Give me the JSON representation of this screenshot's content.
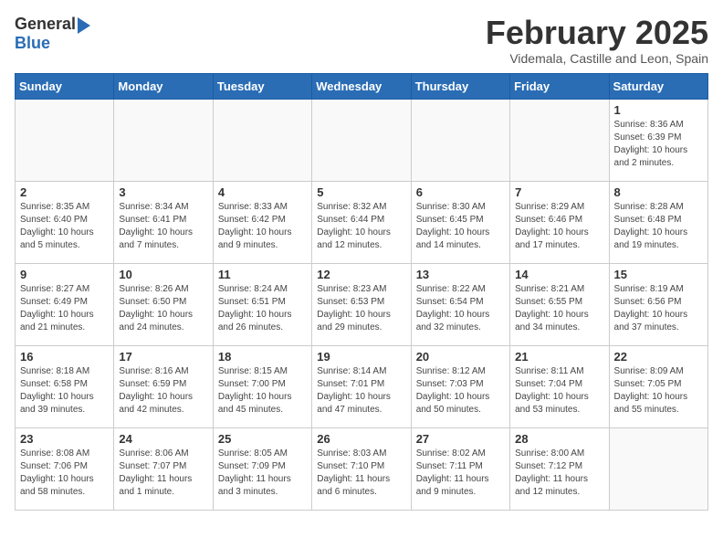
{
  "logo": {
    "general": "General",
    "blue": "Blue"
  },
  "title": "February 2025",
  "subtitle": "Videmala, Castille and Leon, Spain",
  "headers": [
    "Sunday",
    "Monday",
    "Tuesday",
    "Wednesday",
    "Thursday",
    "Friday",
    "Saturday"
  ],
  "weeks": [
    [
      {
        "day": "",
        "info": ""
      },
      {
        "day": "",
        "info": ""
      },
      {
        "day": "",
        "info": ""
      },
      {
        "day": "",
        "info": ""
      },
      {
        "day": "",
        "info": ""
      },
      {
        "day": "",
        "info": ""
      },
      {
        "day": "1",
        "info": "Sunrise: 8:36 AM\nSunset: 6:39 PM\nDaylight: 10 hours\nand 2 minutes."
      }
    ],
    [
      {
        "day": "2",
        "info": "Sunrise: 8:35 AM\nSunset: 6:40 PM\nDaylight: 10 hours\nand 5 minutes."
      },
      {
        "day": "3",
        "info": "Sunrise: 8:34 AM\nSunset: 6:41 PM\nDaylight: 10 hours\nand 7 minutes."
      },
      {
        "day": "4",
        "info": "Sunrise: 8:33 AM\nSunset: 6:42 PM\nDaylight: 10 hours\nand 9 minutes."
      },
      {
        "day": "5",
        "info": "Sunrise: 8:32 AM\nSunset: 6:44 PM\nDaylight: 10 hours\nand 12 minutes."
      },
      {
        "day": "6",
        "info": "Sunrise: 8:30 AM\nSunset: 6:45 PM\nDaylight: 10 hours\nand 14 minutes."
      },
      {
        "day": "7",
        "info": "Sunrise: 8:29 AM\nSunset: 6:46 PM\nDaylight: 10 hours\nand 17 minutes."
      },
      {
        "day": "8",
        "info": "Sunrise: 8:28 AM\nSunset: 6:48 PM\nDaylight: 10 hours\nand 19 minutes."
      }
    ],
    [
      {
        "day": "9",
        "info": "Sunrise: 8:27 AM\nSunset: 6:49 PM\nDaylight: 10 hours\nand 21 minutes."
      },
      {
        "day": "10",
        "info": "Sunrise: 8:26 AM\nSunset: 6:50 PM\nDaylight: 10 hours\nand 24 minutes."
      },
      {
        "day": "11",
        "info": "Sunrise: 8:24 AM\nSunset: 6:51 PM\nDaylight: 10 hours\nand 26 minutes."
      },
      {
        "day": "12",
        "info": "Sunrise: 8:23 AM\nSunset: 6:53 PM\nDaylight: 10 hours\nand 29 minutes."
      },
      {
        "day": "13",
        "info": "Sunrise: 8:22 AM\nSunset: 6:54 PM\nDaylight: 10 hours\nand 32 minutes."
      },
      {
        "day": "14",
        "info": "Sunrise: 8:21 AM\nSunset: 6:55 PM\nDaylight: 10 hours\nand 34 minutes."
      },
      {
        "day": "15",
        "info": "Sunrise: 8:19 AM\nSunset: 6:56 PM\nDaylight: 10 hours\nand 37 minutes."
      }
    ],
    [
      {
        "day": "16",
        "info": "Sunrise: 8:18 AM\nSunset: 6:58 PM\nDaylight: 10 hours\nand 39 minutes."
      },
      {
        "day": "17",
        "info": "Sunrise: 8:16 AM\nSunset: 6:59 PM\nDaylight: 10 hours\nand 42 minutes."
      },
      {
        "day": "18",
        "info": "Sunrise: 8:15 AM\nSunset: 7:00 PM\nDaylight: 10 hours\nand 45 minutes."
      },
      {
        "day": "19",
        "info": "Sunrise: 8:14 AM\nSunset: 7:01 PM\nDaylight: 10 hours\nand 47 minutes."
      },
      {
        "day": "20",
        "info": "Sunrise: 8:12 AM\nSunset: 7:03 PM\nDaylight: 10 hours\nand 50 minutes."
      },
      {
        "day": "21",
        "info": "Sunrise: 8:11 AM\nSunset: 7:04 PM\nDaylight: 10 hours\nand 53 minutes."
      },
      {
        "day": "22",
        "info": "Sunrise: 8:09 AM\nSunset: 7:05 PM\nDaylight: 10 hours\nand 55 minutes."
      }
    ],
    [
      {
        "day": "23",
        "info": "Sunrise: 8:08 AM\nSunset: 7:06 PM\nDaylight: 10 hours\nand 58 minutes."
      },
      {
        "day": "24",
        "info": "Sunrise: 8:06 AM\nSunset: 7:07 PM\nDaylight: 11 hours\nand 1 minute."
      },
      {
        "day": "25",
        "info": "Sunrise: 8:05 AM\nSunset: 7:09 PM\nDaylight: 11 hours\nand 3 minutes."
      },
      {
        "day": "26",
        "info": "Sunrise: 8:03 AM\nSunset: 7:10 PM\nDaylight: 11 hours\nand 6 minutes."
      },
      {
        "day": "27",
        "info": "Sunrise: 8:02 AM\nSunset: 7:11 PM\nDaylight: 11 hours\nand 9 minutes."
      },
      {
        "day": "28",
        "info": "Sunrise: 8:00 AM\nSunset: 7:12 PM\nDaylight: 11 hours\nand 12 minutes."
      },
      {
        "day": "",
        "info": ""
      }
    ]
  ]
}
